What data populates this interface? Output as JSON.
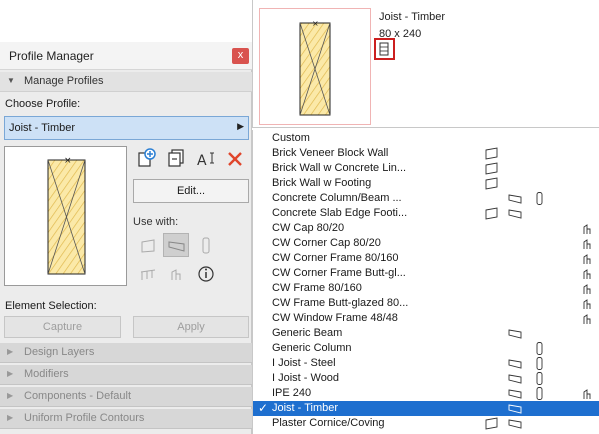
{
  "palette": {
    "title": "Profile Manager",
    "close_label": "x",
    "manage_profiles": "Manage Profiles",
    "choose_profile_label": "Choose Profile:",
    "selected_profile": "Joist - Timber",
    "edit_label": "Edit...",
    "use_with_label": "Use with:",
    "element_selection_label": "Element Selection:",
    "capture_label": "Capture",
    "apply_label": "Apply",
    "sections": [
      "Design Layers",
      "Modifiers",
      "Components - Default",
      "Uniform Profile Contours"
    ]
  },
  "preview": {
    "name": "Joist - Timber",
    "size": "80 x 240"
  },
  "profiles": [
    {
      "name": "Custom",
      "icons": []
    },
    {
      "name": "Brick Veneer Block Wall",
      "icons": [
        "wall"
      ]
    },
    {
      "name": "Brick Wall w Concrete Lin...",
      "icons": [
        "wall"
      ]
    },
    {
      "name": "Brick Wall w Footing",
      "icons": [
        "wall"
      ]
    },
    {
      "name": "Concrete Column/Beam ...",
      "icons": [
        "beam",
        "column"
      ]
    },
    {
      "name": "Concrete Slab Edge Footi...",
      "icons": [
        "wall",
        "beam"
      ]
    },
    {
      "name": "CW Cap 80/20",
      "icons": [
        "curtain"
      ]
    },
    {
      "name": "CW Corner Cap 80/20",
      "icons": [
        "curtain"
      ]
    },
    {
      "name": "CW Corner Frame 80/160",
      "icons": [
        "curtain"
      ]
    },
    {
      "name": "CW Corner Frame Butt-gl...",
      "icons": [
        "curtain"
      ]
    },
    {
      "name": "CW Frame 80/160",
      "icons": [
        "curtain"
      ]
    },
    {
      "name": "CW Frame Butt-glazed 80...",
      "icons": [
        "curtain"
      ]
    },
    {
      "name": "CW Window Frame 48/48",
      "icons": [
        "curtain"
      ]
    },
    {
      "name": "Generic Beam",
      "icons": [
        "beam"
      ]
    },
    {
      "name": "Generic Column",
      "icons": [
        "column"
      ]
    },
    {
      "name": "I Joist - Steel",
      "icons": [
        "beam",
        "column"
      ]
    },
    {
      "name": "I Joist - Wood",
      "icons": [
        "beam",
        "column"
      ]
    },
    {
      "name": "IPE 240",
      "icons": [
        "beam",
        "column",
        "curtain"
      ]
    },
    {
      "name": "Joist - Timber",
      "icons": [
        "beam"
      ]
    },
    {
      "name": "Plaster Cornice/Coving",
      "icons": [
        "wall",
        "beam"
      ]
    }
  ],
  "selected_profile_index": 18
}
